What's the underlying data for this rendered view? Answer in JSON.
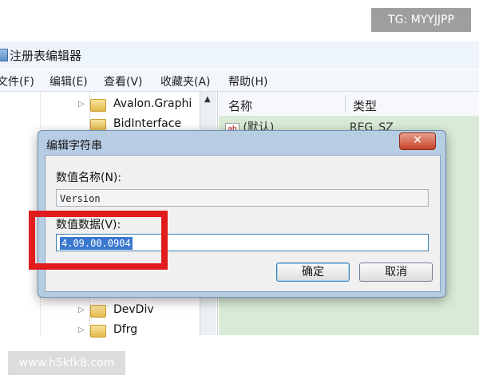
{
  "window": {
    "title": "注册表编辑器"
  },
  "menu": [
    "文件(F)",
    "编辑(E)",
    "查看(V)",
    "收藏夹(A)",
    "帮助(H)"
  ],
  "tree": {
    "items": [
      "Avalon.Graphi",
      "BidInterface",
      "DevDiv",
      "Dfrg"
    ]
  },
  "values_pane": {
    "col_name": "名称",
    "col_type": "类型",
    "row_name": "(默认)",
    "row_type": "REG_SZ"
  },
  "dialog": {
    "title": "编辑字符串",
    "close_label": "✕",
    "name_label": "数值名称(N):",
    "name_value": "Version",
    "data_label": "数值数据(V):",
    "data_value": "4.09.00.0904",
    "ok_label": "确定",
    "cancel_label": "取消"
  },
  "watermarks": {
    "top": "TG: MYYJJPP",
    "bottom": "www.h5kfk8.com"
  },
  "colors": {
    "highlight": "#e01c1c",
    "selection": "#3a78d0",
    "values_bg": "#d9ebd6"
  }
}
